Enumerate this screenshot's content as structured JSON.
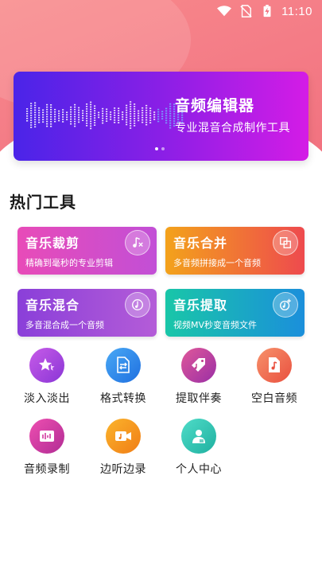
{
  "status_bar": {
    "time": "11:10"
  },
  "banner": {
    "title": "音频编辑器",
    "subtitle": "专业混音合成制作工具"
  },
  "section_title": "热门工具",
  "cards": [
    {
      "title": "音乐裁剪",
      "subtitle": "精确到毫秒的专业剪辑",
      "icon": "music-cut-icon"
    },
    {
      "title": "音乐合并",
      "subtitle": "多音频拼接成一个音频",
      "icon": "merge-icon"
    },
    {
      "title": "音乐混合",
      "subtitle": "多音混合成一个音频",
      "icon": "mix-icon"
    },
    {
      "title": "音乐提取",
      "subtitle": "视频MV秒变音频文件",
      "icon": "extract-icon"
    }
  ],
  "tools": [
    {
      "label": "淡入淡出",
      "icon": "star-fade-icon",
      "color": "#b03fe0"
    },
    {
      "label": "格式转换",
      "icon": "file-convert-icon",
      "color": "#2f8cf0"
    },
    {
      "label": "提取伴奏",
      "icon": "tag-music-icon",
      "color": "#c23b8c"
    },
    {
      "label": "空白音频",
      "icon": "blank-audio-icon",
      "color": "#f07055"
    },
    {
      "label": "音频录制",
      "icon": "record-icon",
      "color": "#d23aa0"
    },
    {
      "label": "边听边录",
      "icon": "video-record-icon",
      "color": "#f59a1c"
    },
    {
      "label": "个人中心",
      "icon": "user-icon",
      "color": "#2fc4b0"
    }
  ]
}
